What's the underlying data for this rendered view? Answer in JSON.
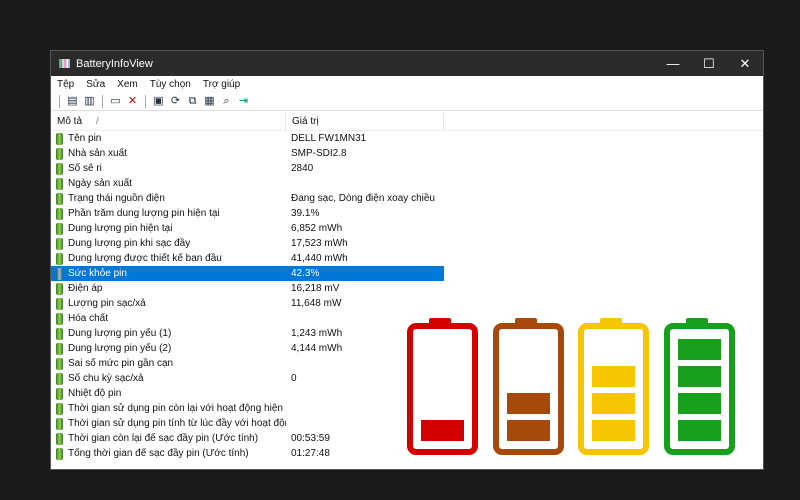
{
  "window": {
    "title": "BatteryInfoView",
    "minimize": "—",
    "maximize": "☐",
    "close": "✕"
  },
  "menu": [
    "Tệp",
    "Sửa",
    "Xem",
    "Tùy chọn",
    "Trợ giúp"
  ],
  "columns": {
    "desc": "Mô tả",
    "sort": "/",
    "value": "Giá trị"
  },
  "rows": [
    {
      "label": "Tên pin",
      "value": "DELL FW1MN31"
    },
    {
      "label": "Nhà sản xuất",
      "value": "SMP-SDI2.8"
    },
    {
      "label": "Số sê ri",
      "value": "2840"
    },
    {
      "label": "Ngày sản xuất",
      "value": ""
    },
    {
      "label": "Trạng thái nguồn điện",
      "value": "Đang sạc, Dòng điện xoay chiều"
    },
    {
      "label": "Phần trăm dung lượng pin hiện tại",
      "value": "39.1%"
    },
    {
      "label": "Dung lượng pin hiện tại",
      "value": "6,852 mWh"
    },
    {
      "label": "Dung lượng pin khi sạc đầy",
      "value": "17,523 mWh"
    },
    {
      "label": "Dung lượng được thiết kế ban đầu",
      "value": "41,440 mWh"
    },
    {
      "label": "Sức khỏe pin",
      "value": "42.3%"
    },
    {
      "label": "Điện áp",
      "value": "16,218 mV"
    },
    {
      "label": "Lượng pin sạc/xả",
      "value": "11,648 mW"
    },
    {
      "label": "Hóa chất",
      "value": ""
    },
    {
      "label": "Dung lượng pin yếu (1)",
      "value": "1,243 mWh"
    },
    {
      "label": "Dung lượng pin yếu (2)",
      "value": "4,144 mWh"
    },
    {
      "label": "Sai số mức pin gần cạn",
      "value": ""
    },
    {
      "label": "Số chu kỳ sạc/xả",
      "value": "0"
    },
    {
      "label": "Nhiệt độ pin",
      "value": ""
    },
    {
      "label": "Thời gian sử dụng pin còn lại với hoạt động hiện t...",
      "value": ""
    },
    {
      "label": "Thời gian sử dụng pin tính từ lúc đầy với hoạt độn...",
      "value": ""
    },
    {
      "label": "Thời gian còn lại để sạc đầy pin (Ước tính)",
      "value": "00:53:59"
    },
    {
      "label": "Tổng thời gian để sạc đầy pin (Ước tính)",
      "value": "01:27:48"
    }
  ],
  "selected_index": 9,
  "battery_levels": [
    {
      "color": "#d40000",
      "bars": 1
    },
    {
      "color": "#a8490c",
      "bars": 2
    },
    {
      "color": "#f7c600",
      "bars": 3
    },
    {
      "color": "#16a01c",
      "bars": 4
    }
  ]
}
